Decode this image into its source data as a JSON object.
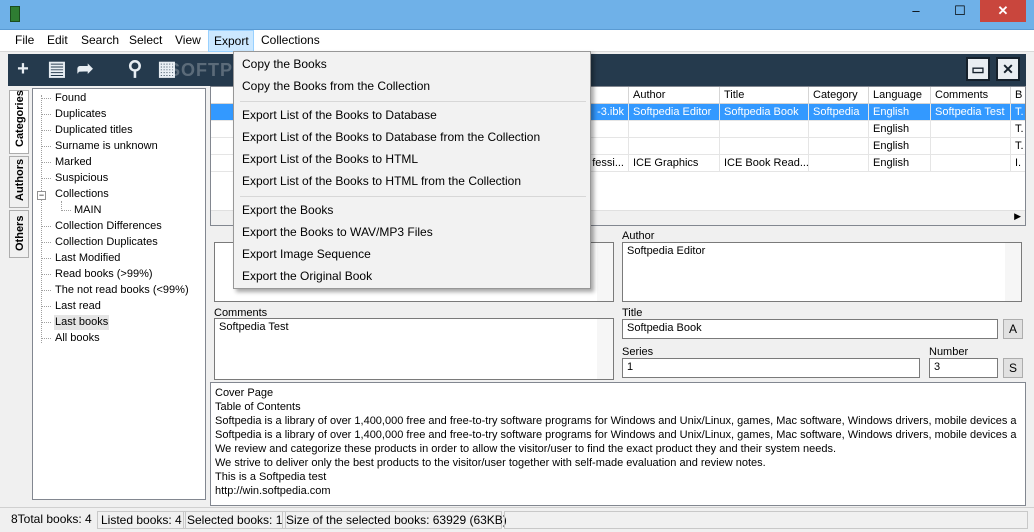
{
  "menubar": [
    "File",
    "Edit",
    "Search",
    "Select",
    "View",
    "Export",
    "Collections"
  ],
  "window": {
    "minimize": "–",
    "maximize": "☐",
    "close": "✕"
  },
  "toolbar": {
    "watermark": "SOFTPEDIA"
  },
  "tabs": [
    "Categories",
    "Authors",
    "Others"
  ],
  "tree": [
    "Found",
    "Duplicates",
    "Duplicated titles",
    "Surname is unknown",
    "Marked",
    "Suspicious",
    "Collections",
    "MAIN",
    "Collection Differences",
    "Collection Duplicates",
    "Last Modified",
    "Read books (>99%)",
    "The not read books (<99%)",
    "Last read",
    "Last books",
    "All books"
  ],
  "grid": {
    "headers": [
      "Author",
      "Title",
      "Category",
      "Language",
      "Comments",
      "B"
    ],
    "rows": [
      {
        "file": "-3.ibk",
        "author": "Softpedia Editor",
        "title": "Softpedia Book",
        "category": "Softpedia",
        "language": "English",
        "comments": "Softpedia Test",
        "b": "T."
      },
      {
        "file": "",
        "author": "",
        "title": "",
        "category": "",
        "language": "English",
        "comments": "",
        "b": "T."
      },
      {
        "file": "",
        "author": "",
        "title": "",
        "category": "",
        "language": "English",
        "comments": "",
        "b": "T."
      },
      {
        "file": "fessi...",
        "author": "ICE Graphics",
        "title": "ICE Book Read...",
        "category": "",
        "language": "English",
        "comments": "",
        "b": "I."
      }
    ]
  },
  "fields": {
    "author_label": "Author",
    "author_value": "Softpedia Editor",
    "comments_label": "Comments",
    "comments_value": "Softpedia Test",
    "title_label": "Title",
    "title_value": "Softpedia Book",
    "title_button": "A",
    "series_label": "Series",
    "series_value": "1",
    "number_label": "Number",
    "number_value": "3",
    "number_button": "S"
  },
  "description": [
    "Cover Page",
    "Table of Contents",
    "Softpedia is a library of over 1,400,000 free and free-to-try software programs for Windows and Unix/Linux, games, Mac software, Windows drivers, mobile devices a",
    "Softpedia is a library of over 1,400,000 free and free-to-try software programs for Windows and Unix/Linux, games, Mac software, Windows drivers, mobile devices a",
    "We review and categorize these products in order to allow the visitor/user to find the exact product they and their system needs.",
    "We strive to deliver only the best products to the visitor/user together with self-made evaluation and review notes.",
    "This is a Softpedia test",
    "http://win.softpedia.com"
  ],
  "status": [
    "8Total books: 4",
    "Listed books: 4",
    "Selected books: 1",
    "Size of the selected books: 63929  (63KB)"
  ],
  "export_menu": [
    [
      "Copy the Books",
      "Copy the Books from the Collection"
    ],
    [
      "Export List of the Books to Database",
      "Export List of the Books to Database from the Collection",
      "Export List of the Books to HTML",
      "Export List of the Books to HTML from the Collection"
    ],
    [
      "Export the Books",
      "Export the Books to WAV/MP3 Files",
      "Export Image Sequence",
      "Export the Original Book"
    ]
  ]
}
